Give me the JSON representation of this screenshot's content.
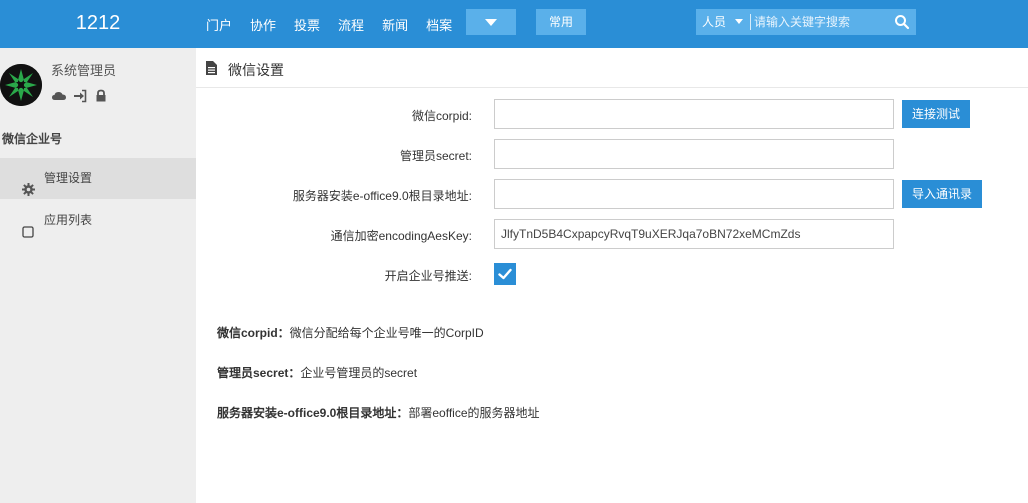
{
  "app": {
    "brand": "1212",
    "nav": [
      "门户",
      "协作",
      "投票",
      "流程",
      "新闻",
      "档案"
    ],
    "common_label": "常用",
    "search": {
      "type_label": "人员",
      "placeholder": "请输入关键字搜索"
    },
    "icons": {
      "more": "chevron-down-icon",
      "search": "search-icon"
    }
  },
  "sidebar": {
    "user_name": "系统管理员",
    "user_icons": [
      "cloud-icon",
      "sign-in-icon",
      "lock-icon"
    ],
    "module_title": "微信企业号",
    "items": [
      {
        "label": "管理设置",
        "icon": "gear-icon",
        "active": true
      },
      {
        "label": "应用列表",
        "icon": "square-icon",
        "active": false
      }
    ]
  },
  "page": {
    "title": "微信设置",
    "title_icon": "file-icon"
  },
  "form": {
    "corpid_label": "微信corpid:",
    "corpid_value": "",
    "connect_test_label": "连接测试",
    "secret_label": "管理员secret:",
    "secret_value": "",
    "server_label": "服务器安装e-office9.0根目录地址:",
    "server_value": "",
    "import_contacts_label": "导入通讯录",
    "aeskey_label": "通信加密encodingAesKey:",
    "aeskey_value": "JlfyTnD5B4CxpapcyRvqT9uXERJqa7oBN72xeMCmZds",
    "push_label": "开启企业号推送:",
    "push_enabled": true
  },
  "notes": [
    {
      "term": "微信corpid：",
      "desc": "微信分配给每个企业号唯一的CorpID"
    },
    {
      "term": "管理员secret：",
      "desc": "企业号管理员的secret"
    },
    {
      "term": "服务器安装e-office9.0根目录地址：",
      "desc": "部署eoffice的服务器地址"
    }
  ],
  "colors": {
    "primary": "#2a8ed6",
    "primary_light": "#5ab0ea",
    "sidebar_bg": "#eeeeee",
    "sidebar_active": "#dedede"
  }
}
